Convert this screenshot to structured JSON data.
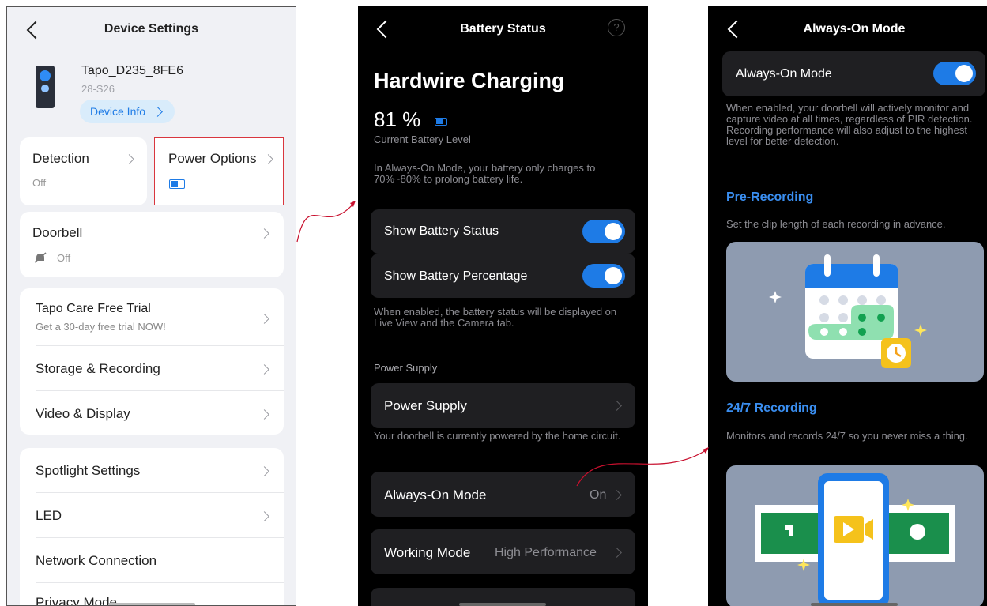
{
  "colors": {
    "accent": "#1e7be6",
    "highlight": "#d9363e",
    "callout": "#c8102e"
  },
  "device_settings": {
    "title": "Device Settings",
    "device_name": "Tapo_D235_8FE6",
    "device_model": "28-S26",
    "device_info_button": "Device Info",
    "detection": {
      "label": "Detection",
      "value": "Off"
    },
    "power_options": {
      "label": "Power Options",
      "icon": "battery-icon"
    },
    "doorbell": {
      "label": "Doorbell",
      "value": "Off",
      "icon": "bell-off-icon"
    },
    "menu_group1": [
      {
        "label": "Tapo Care Free Trial",
        "sub": "Get a 30-day free trial NOW!"
      },
      {
        "label": "Storage & Recording"
      },
      {
        "label": "Video & Display"
      }
    ],
    "menu_group2": [
      {
        "label": "Spotlight Settings"
      },
      {
        "label": "LED"
      },
      {
        "label": "Network Connection"
      },
      {
        "label": "Privacy Mode"
      }
    ]
  },
  "battery_status": {
    "title": "Battery Status",
    "heading": "Hardwire Charging",
    "percent": "81 %",
    "level_label": "Current Battery Level",
    "note": "In Always-On Mode, your battery only charges to 70%~80% to prolong battery life.",
    "show_status": "Show Battery Status",
    "show_percent": "Show Battery Percentage",
    "toggle_note": "When enabled, the battery status will be displayed on Live View and the Camera tab.",
    "power_supply_section": "Power Supply",
    "power_supply_row": "Power Supply",
    "power_note": "Your doorbell is currently powered by the home circuit.",
    "always_on": {
      "label": "Always-On Mode",
      "value": "On"
    },
    "working_mode": {
      "label": "Working Mode",
      "value": "High Performance"
    }
  },
  "always_on_mode": {
    "title": "Always-On Mode",
    "toggle_label": "Always-On Mode",
    "desc": "When enabled, your doorbell will actively monitor and capture video at all times, regardless of PIR detection. Recording performance will also adjust to the highest level for better detection.",
    "pre_recording_title": "Pre-Recording",
    "pre_recording_desc": "Set the clip length of each recording in advance.",
    "rec247_title": "24/7 Recording",
    "rec247_desc": "Monitors and records 24/7 so you never miss a thing."
  }
}
